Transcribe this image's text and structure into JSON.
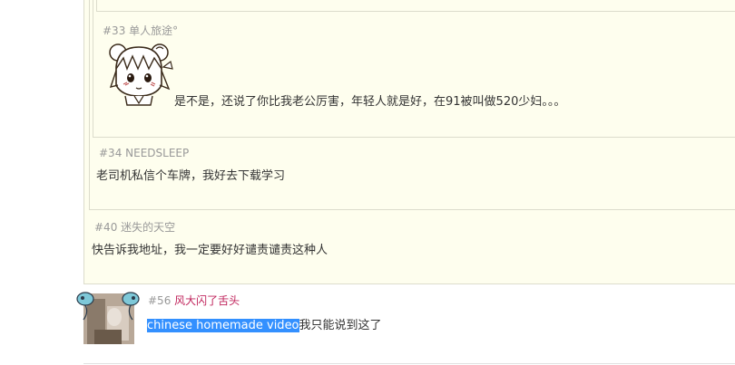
{
  "thread": {
    "quote_33": {
      "floor": "#33",
      "username": "单人旅途°",
      "text": "是不是，还说了你比我老公厉害，年轻人就是好，在91被叫做520少妇。。。"
    },
    "quote_34": {
      "floor": "#34",
      "username": "NEEDSLEEP",
      "text": "老司机私信个车牌，我好去下载学习"
    },
    "quote_40": {
      "floor": "#40",
      "username": "迷失的天空",
      "text": "快告诉我地址，我一定要好好谴责谴责这种人"
    },
    "reply_56": {
      "floor": "#56",
      "username": "风大闪了舌头",
      "highlighted_text": "chinese homemade video",
      "text": "我只能说到这了"
    }
  },
  "colors": {
    "quote_bg": "#fefeee",
    "quote_border": "#dcdccc",
    "username_link": "#c0245c",
    "selection": "#3390ff"
  }
}
